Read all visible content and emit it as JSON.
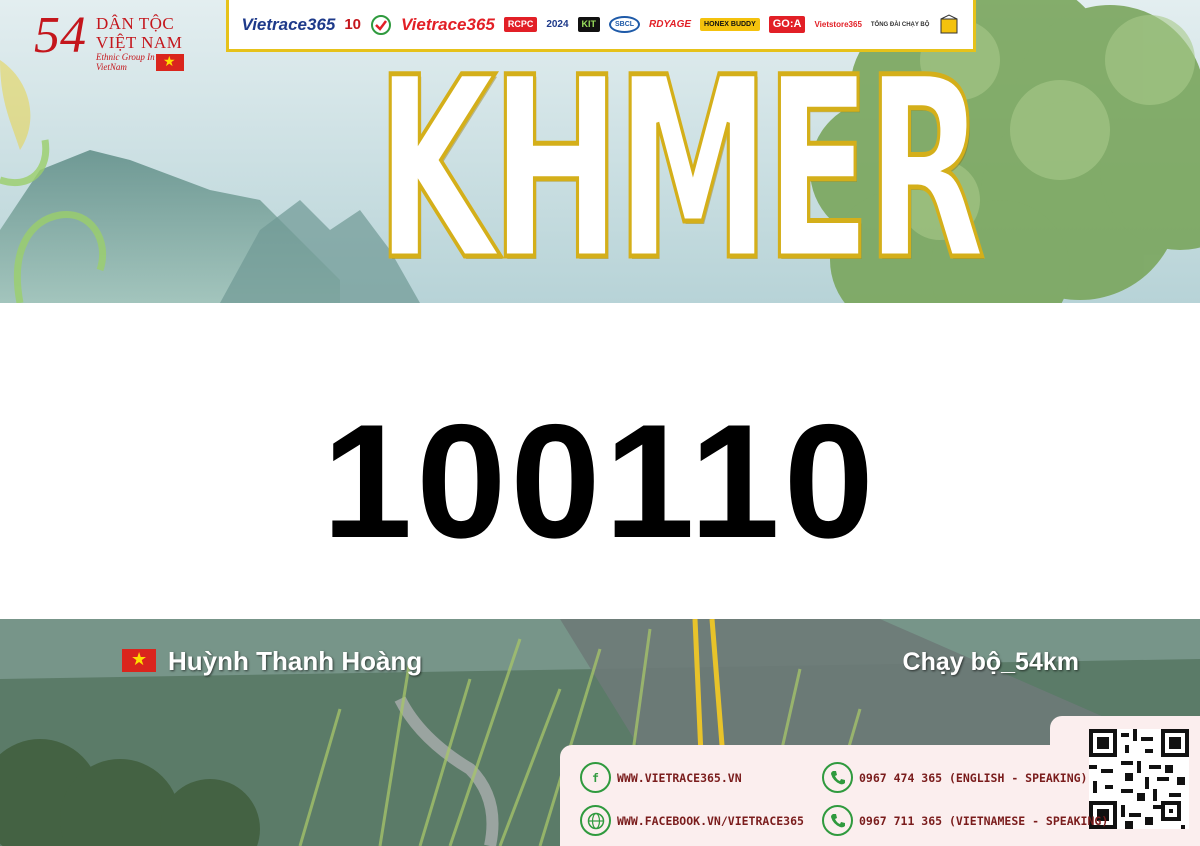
{
  "header": {
    "logo": {
      "number": "54",
      "line1": "DÂN TỘC",
      "line2": "VIỆT NAM",
      "line3": "Ethnic Group In VietNam"
    },
    "sponsors": [
      "Vietrace365",
      "10",
      "Vietrace365",
      "RCPC",
      "2024",
      "KIT",
      "SBCL",
      "RDYAGE",
      "HONEX BUDDY",
      "GO:A",
      "Vietstore365",
      "TỔNG ĐÀI CHẠY BỘ"
    ],
    "event_title": "KHMER"
  },
  "bib": {
    "number": "100110"
  },
  "runner": {
    "name": "Huỳnh Thanh Hoàng",
    "distance": "Chạy bộ_54km"
  },
  "contacts": {
    "website": "WWW.VIETRACE365.VN",
    "facebook": "WWW.FACEBOOK.VN/VIETRACE365",
    "phone_en": "0967 474 365 (ENGLISH - SPEAKING)",
    "phone_vn": "0967 711 365 (VIETNAMESE - SPEAKING)"
  },
  "colors": {
    "brand_red": "#c4161c",
    "gold": "#e6c21a",
    "contact_text": "#7a1c1c",
    "icon_green": "#2f9a3e"
  }
}
